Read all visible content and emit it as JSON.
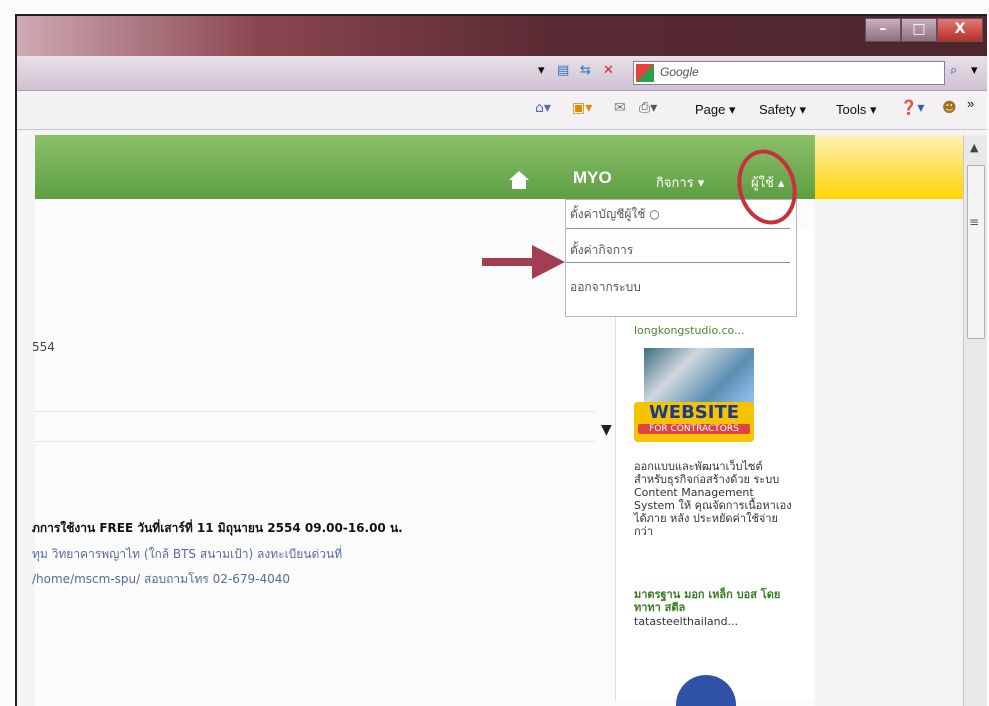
{
  "browser": {
    "search_engine": "Google",
    "window_buttons": [
      "–",
      "□",
      "X"
    ],
    "toolbar_items": [
      "Page",
      "Safety",
      "Tools"
    ],
    "toolbar_more": "»"
  },
  "site": {
    "home_icon": "home-icon",
    "logo": "MYO",
    "nav": [
      {
        "label": "กิจการ ▾"
      },
      {
        "label": "ผู้ใช้ ▴"
      }
    ],
    "dropdown": {
      "items": [
        "ตั้งค่าบัญชีผู้ใช้ ○",
        "ตั้งค่ากิจการ",
        "ออกจากระบบ"
      ]
    },
    "main": {
      "year_fragment": "554",
      "notice_title": "ภการใช้งาน FREE วันที่เสาร์ที่ 11 มิถุนายน 2554 09.00-16.00 น.",
      "notice_line2": "ทุม วิทยาคารพญาไท (ใกล้ BTS สนามเป้า) ลงทะเบียนด่วนที่",
      "notice_line3": "/home/mscm-spu/ สอบถามโทร 02-679-4040"
    },
    "sidebar": {
      "ad1_url": "longkongstudio.co...",
      "ad1_image_title": "WEBSITE",
      "ad1_image_sub": "FOR CONTRACTORS",
      "ad1_desc": "ออกแบบและพัฒนาเว็บไซต์ สำหรับธุรกิจก่อสร้างด้วย ระบบ Content Management System ให้ คุณจัดการเนื้อหาเองได้ภาย หลัง ประหยัดค่าใช้จ่ายกว่า",
      "ad2_title": "มาตรฐาน มอก เหล็ก บอส โดย ทาทา สตีล",
      "ad2_url": "tatasteelthailand..."
    }
  },
  "colors": {
    "title_bar": "#5a2a33",
    "green_bar": "#5f9e43",
    "yellow": "#ffd400",
    "annotation_red": "#c8313b",
    "arrow": "#a33d51"
  }
}
